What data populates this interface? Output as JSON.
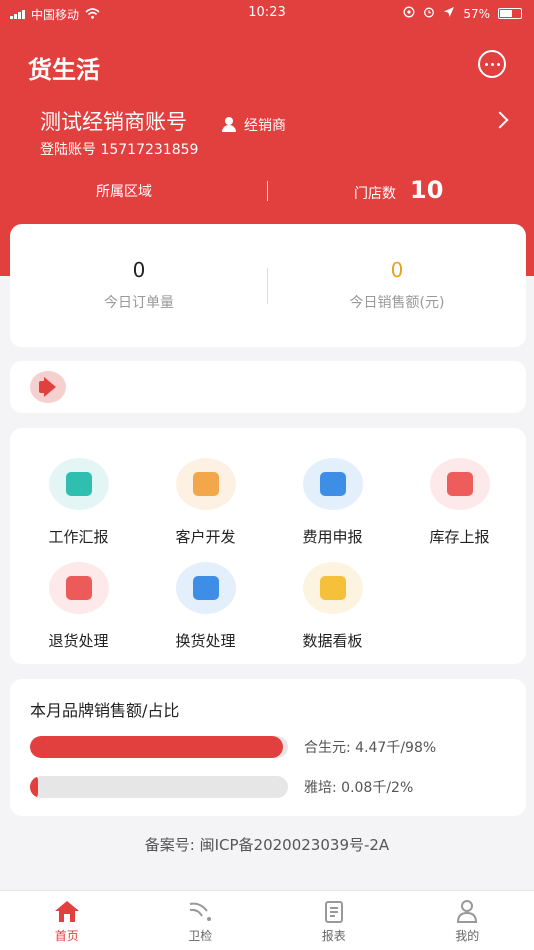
{
  "status_bar": {
    "carrier": "中国移动",
    "time": "10:23",
    "battery": "57%"
  },
  "header": {
    "title": "货生活",
    "account_name": "测试经销商账号",
    "role": "经销商",
    "login_label": "登陆账号",
    "login_account": "15717231859",
    "region_label": "所属区域",
    "stores_label": "门店数",
    "stores_count": "10"
  },
  "stats": {
    "orders": {
      "value": "0",
      "label": "今日订单量"
    },
    "sales": {
      "value": "0",
      "label": "今日销售额(元)"
    }
  },
  "menu": [
    {
      "label": "工作汇报",
      "icon": "work-report-icon",
      "bg": "#e3f6f5",
      "fg": "#2fbfb1"
    },
    {
      "label": "客户开发",
      "icon": "customer-dev-icon",
      "bg": "#fdf1e3",
      "fg": "#f2a74a"
    },
    {
      "label": "费用申报",
      "icon": "expense-report-icon",
      "bg": "#e4effc",
      "fg": "#3f8ee6"
    },
    {
      "label": "库存上报",
      "icon": "inventory-report-icon",
      "bg": "#fde9e9",
      "fg": "#ee5c5c"
    },
    {
      "label": "退货处理",
      "icon": "return-icon",
      "bg": "#fde9e9",
      "fg": "#ec5a5a"
    },
    {
      "label": "换货处理",
      "icon": "exchange-icon",
      "bg": "#e4effc",
      "fg": "#3f8ee6"
    },
    {
      "label": "数据看板",
      "icon": "dashboard-icon",
      "bg": "#fdf3e1",
      "fg": "#f5c13a"
    }
  ],
  "brand_sales": {
    "title": "本月品牌销售额/占比",
    "items": [
      {
        "name": "合生元",
        "text": "合生元:  4.47千/98%",
        "ratio": 0.98
      },
      {
        "name": "雅培",
        "text": "雅培:  0.08千/2%",
        "ratio": 0.02
      }
    ]
  },
  "footer": {
    "beian": "备案号:  闽ICP备2020023039号-2A"
  },
  "tabs": [
    {
      "label": "首页",
      "icon": "home-icon",
      "active": true
    },
    {
      "label": "卫检",
      "icon": "inspection-icon",
      "active": false
    },
    {
      "label": "报表",
      "icon": "report-icon",
      "active": false
    },
    {
      "label": "我的",
      "icon": "profile-icon",
      "active": false
    }
  ],
  "colors": {
    "primary": "#e23f3f",
    "accent": "#e8a320"
  }
}
